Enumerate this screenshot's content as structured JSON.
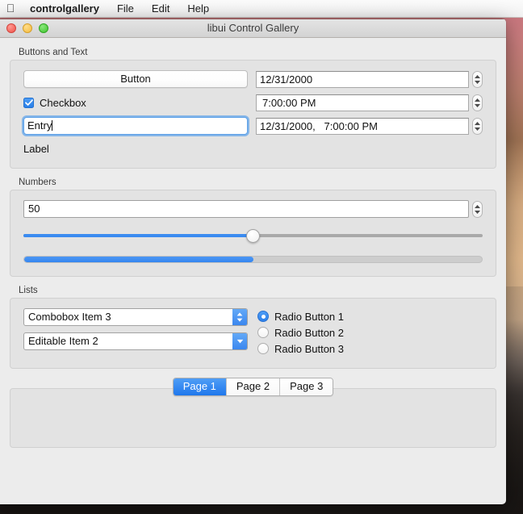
{
  "menubar": {
    "apple_icon": "apple-logo-icon",
    "app_name": "controlgallery",
    "items": [
      "File",
      "Edit",
      "Help"
    ]
  },
  "window": {
    "title": "libui Control Gallery",
    "traffic_lights": {
      "close": "close-button",
      "minimize": "minimize-button",
      "maximize": "zoom-button"
    }
  },
  "groups": {
    "buttons_and_text": {
      "title": "Buttons and Text",
      "button_label": "Button",
      "checkbox": {
        "label": "Checkbox",
        "checked": true
      },
      "entry": {
        "value": "Entry",
        "focused": true
      },
      "label": "Label",
      "date_picker": {
        "value": "12/31/2000"
      },
      "time_picker": {
        "value": "7:00:00 PM"
      },
      "datetime_picker": {
        "value": "12/31/2000,   7:00:00 PM"
      }
    },
    "numbers": {
      "title": "Numbers",
      "spinbox": {
        "value": "50"
      },
      "slider": {
        "value": 50,
        "min": 0,
        "max": 100
      },
      "progressbar": {
        "value": 50,
        "min": 0,
        "max": 100
      }
    },
    "lists": {
      "title": "Lists",
      "combobox": {
        "value": "Combobox Item 3"
      },
      "editable_combobox": {
        "value": "Editable Item 2"
      },
      "radio_buttons": [
        {
          "label": "Radio Button 1",
          "selected": true
        },
        {
          "label": "Radio Button 2",
          "selected": false
        },
        {
          "label": "Radio Button 3",
          "selected": false
        }
      ]
    }
  },
  "tabs": [
    {
      "label": "Page 1",
      "active": true
    },
    {
      "label": "Page 2",
      "active": false
    },
    {
      "label": "Page 3",
      "active": false
    }
  ],
  "colors": {
    "accent_blue": "#3b8bf0",
    "window_bg": "#ececec",
    "group_bg": "#e3e3e3",
    "focus_ring": "#67a7e9"
  }
}
